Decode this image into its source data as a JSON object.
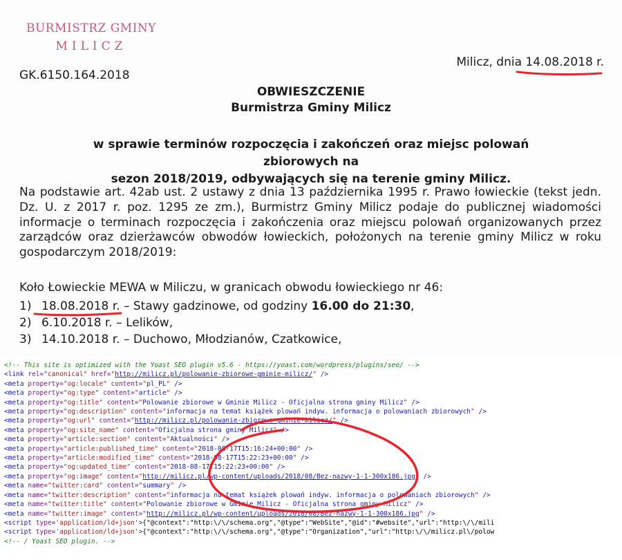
{
  "document": {
    "stamp_line1": "BURMISTRZ GMINY",
    "stamp_line2": "MILICZ",
    "place_date_prefix": "Milicz, dnia ",
    "date": "14.08.2018 r.",
    "reference": "GK.6150.164.2018",
    "title": "OBWIESZCZENIE",
    "issuer": "Burmistrza Gminy Milicz",
    "subject_line1": "w sprawie terminów rozpoczęcia i zakończeń oraz miejsc polowań zbiorowych na",
    "subject_line2": "sezon 2018/2019, odbywających się na terenie gminy Milicz.",
    "body": "Na podstawie art. 42ab ust. 2 ustawy z dnia 13 października 1995 r. Prawo łowieckie (tekst jedn. Dz. U. z 2017 r. poz. 1295 ze zm.), Burmistrz Gminy Milicz podaje do publicznej wiadomości informacje o terminach rozpoczęcia i zakończenia oraz miejscu polowań organizowanych przez zarządców oraz dzierżawców obwodów łowieckich, położonych na terenie gminy Milicz w roku gospodarczym 2018/2019:",
    "club_line": "Koło Łowieckie MEWA w Miliczu, w granicach obwodu łowieckiego nr 46:",
    "hunts": [
      {
        "num": "1)",
        "date": "18.08.2018 r.",
        "place": " – Stawy gadzinowe, od godziny ",
        "time": "16.00 do 21:30",
        "tail": ","
      },
      {
        "num": "2)",
        "date": "6.10.2018 r.",
        "place": " – Lelików,",
        "time": "",
        "tail": ""
      },
      {
        "num": "3)",
        "date": "14.10.2018 r.",
        "place": " – Duchowo, Młodzianów, Czatkowice,",
        "time": "",
        "tail": ""
      }
    ]
  },
  "source": {
    "comment_open": "<!-- This site is optimized with the Yoast SEO plugin v5.6 - https://yoast.com/wordpress/plugins/seo/ -->",
    "canonical_href": "http://milicz.pl/polowanie-zbiorowe-gminie-milicz/",
    "metas": [
      {
        "kind": "property",
        "key": "og:locale",
        "content": "pl_PL"
      },
      {
        "kind": "property",
        "key": "og:type",
        "content": "article"
      },
      {
        "kind": "property",
        "key": "og:title",
        "content": "Polowanie zbiorowe w Gminie Milicz - Oficjalna strona gminy Milicz"
      },
      {
        "kind": "property",
        "key": "og:description",
        "content": "informacja na temat książek plowań indyw. informacja o polowaniach zbiorowych"
      },
      {
        "kind": "property",
        "key": "og:url",
        "content": "http://milicz.pl/polowanie-zbiorowe-gminie-milicz/",
        "link": true
      },
      {
        "kind": "property",
        "key": "og:site_name",
        "content": "Oficjalna strona gminy Milicz"
      },
      {
        "kind": "property",
        "key": "article:section",
        "content": "Aktualności"
      },
      {
        "kind": "property",
        "key": "article:published_time",
        "content": "2018-08-17T15:16:24+00:00"
      },
      {
        "kind": "property",
        "key": "article:modified_time",
        "content": "2018-08-17T15:22:23+00:00"
      },
      {
        "kind": "property",
        "key": "og:updated_time",
        "content": "2018-08-17T15:22:23+00:00"
      },
      {
        "kind": "property",
        "key": "og:image",
        "content": "http://milicz.pl/wp-content/uploads/2018/08/Bez-nazwy-1-1-300x186.jpg",
        "link": true
      },
      {
        "kind": "name",
        "key": "twitter:card",
        "content": "summary"
      },
      {
        "kind": "name",
        "key": "twitter:description",
        "content": "informacja na temat książek plowań indyw. informacja o polowaniach zbiorowych"
      },
      {
        "kind": "name",
        "key": "twitter:title",
        "content": "Polowanie zbiorowe w Gminie Milicz - Oficjalna strona gminy Milicz"
      },
      {
        "kind": "name",
        "key": "twitter:image",
        "content": "http://milicz.pl/wp-content/uploads/2018/08/Bez-nazwy-1-1-300x186.jpg",
        "link": true
      }
    ],
    "script1": "{\"@context\":\"http:\\/\\/schema.org\",\"@type\":\"WebSite\",\"@id\":\"#website\",\"url\":\"http:\\/\\/mili",
    "script2": "{\"@context\":\"http:\\/\\/schema.org\",\"@type\":\"Organization\",\"url\":\"http:\\/\\/milicz.pl\\/polow",
    "comment_close": "<!-- / Yoast SEO plugin. -->"
  },
  "colors": {
    "stamp": "#c45a78",
    "annotation_red": "#e8242f"
  }
}
